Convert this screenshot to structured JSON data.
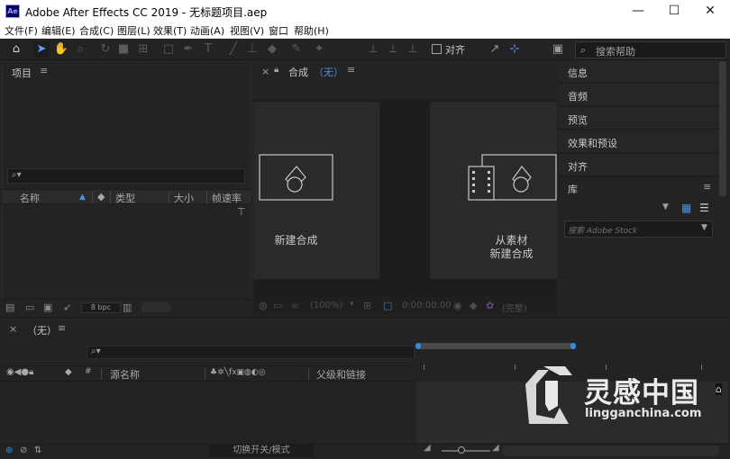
{
  "window": {
    "app_badge": "Ae",
    "title": "Adobe After Effects CC 2019 - 无标题项目.aep",
    "minimize": "—",
    "maximize": "☐",
    "close": "✕"
  },
  "menu": [
    "文件(F)",
    "编辑(E)",
    "合成(C)",
    "图层(L)",
    "效果(T)",
    "动画(A)",
    "视图(V)",
    "窗口",
    "帮助(H)"
  ],
  "toolbar": {
    "tools": [
      "home-icon",
      "selection-icon",
      "hand-icon",
      "zoom-icon",
      "rotate-icon",
      "camera-icon",
      "pan-behind-icon",
      "rectangle-icon",
      "pen-icon",
      "type-icon",
      "brush-icon",
      "clone-stamp-icon",
      "eraser-icon",
      "roto-brush-icon",
      "puppet-pin-icon"
    ],
    "snap_label": "对齐",
    "search_placeholder": "搜索帮助"
  },
  "project": {
    "title": "项目",
    "columns": [
      "名称",
      "类型",
      "大小",
      "帧速率"
    ],
    "bpc": "8 bpc"
  },
  "composition": {
    "tab_label": "合成",
    "tab_value": "（无）",
    "new_comp": "新建合成",
    "from_footage_line1": "从素材",
    "from_footage_line2": "新建合成",
    "zoom": "(100%)",
    "timecode": "0:00:00:00",
    "quality": "(完整)"
  },
  "right_panels": {
    "items": [
      "信息",
      "音频",
      "预览",
      "效果和预设",
      "对齐"
    ],
    "library_title": "库",
    "library_search_placeholder": "搜索 Adobe Stock"
  },
  "timeline": {
    "tab_value": "（无）",
    "col_source_name": "源名称",
    "col_parent": "父级和链接",
    "toggle_label": "切换开关/模式"
  },
  "watermark": {
    "title": "灵感中国",
    "url": "lingganchina.com"
  },
  "colors": {
    "accent_blue": "#2d8ceb",
    "comp_blue": "#4a90e2",
    "panel_bg": "#232323",
    "viewer_bg": "#1d1d1d"
  }
}
